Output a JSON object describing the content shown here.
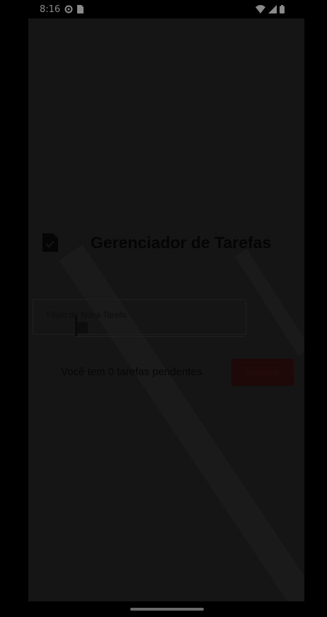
{
  "status_bar": {
    "time": "8:16",
    "icons": [
      "settings-status-icon",
      "sim-card-icon",
      "wifi-icon",
      "signal-icon",
      "battery-icon"
    ]
  },
  "app": {
    "title": "Gerenciador de Tarefas",
    "title_icon": "document-check-icon"
  },
  "task_input": {
    "label": "Título da Nova Tarefa",
    "value": ""
  },
  "pending": {
    "text": "Você tem 0 tarefas pendentes"
  },
  "add_button": {
    "label": "Adicionar"
  },
  "colors": {
    "background": "#000000",
    "screen": "#151515",
    "accent": "#1e0808"
  }
}
